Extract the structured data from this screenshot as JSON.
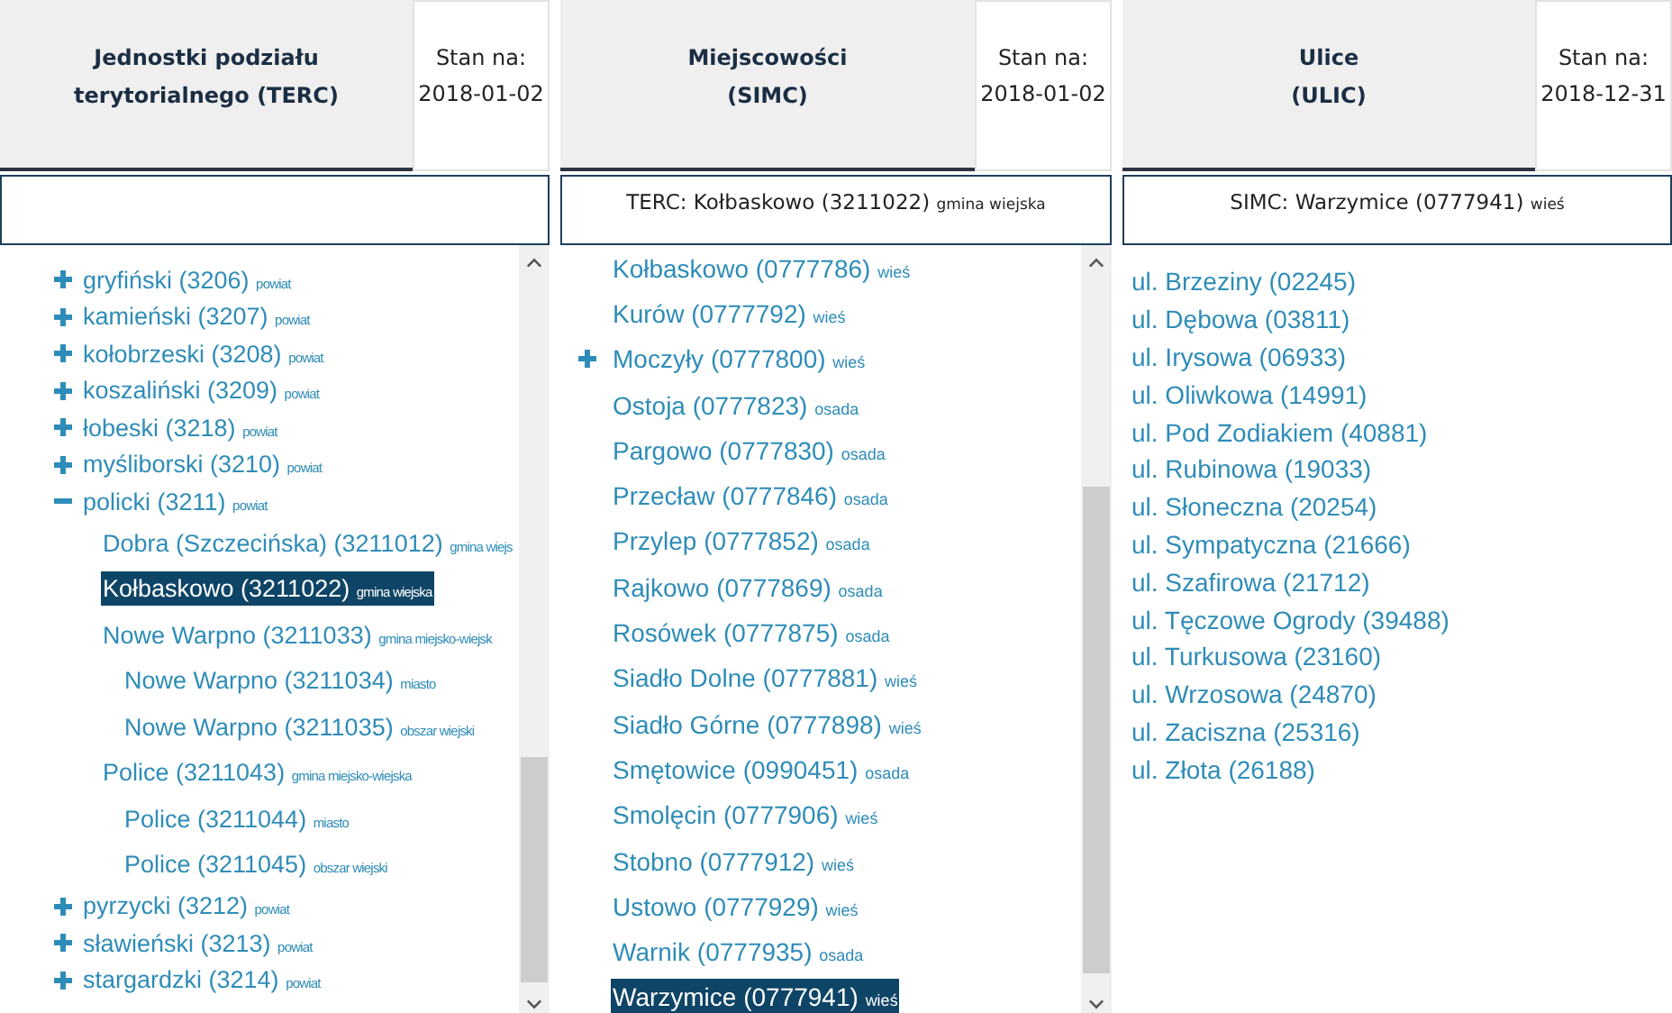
{
  "panels": [
    {
      "kind": "tree",
      "title_lines": [
        "Jednostki podziału",
        "terytorialnego (TERC)"
      ],
      "date_label": "Stan na:",
      "date": "2018-01-02",
      "items": [
        {
          "name": "gryfiński (3206)",
          "type": "powiat",
          "expanded": false,
          "selected": false
        },
        {
          "name": "kamieński (3207)",
          "type": "powiat",
          "expanded": false,
          "selected": false
        },
        {
          "name": "kołobrzeski (3208)",
          "type": "powiat",
          "expanded": false,
          "selected": false
        },
        {
          "name": "koszaliński (3209)",
          "type": "powiat",
          "expanded": false,
          "selected": false
        },
        {
          "name": "łobeski (3218)",
          "type": "powiat",
          "expanded": false,
          "selected": false
        },
        {
          "name": "myśliborski (3210)",
          "type": "powiat",
          "expanded": false,
          "selected": false
        },
        {
          "name": "policki (3211)",
          "type": "powiat",
          "expanded": true,
          "selected": false,
          "children": [
            {
              "name": "Dobra (Szczecińska) (3211012)",
              "type": "gmina wiejs",
              "selected": false
            },
            {
              "name": "Kołbaskowo (3211022)",
              "type": "gmina wiejska",
              "selected": true
            },
            {
              "name": "Nowe Warpno (3211033)",
              "type": "gmina miejsko-wiejsk",
              "selected": false,
              "children": [
                {
                  "name": "Nowe Warpno (3211034)",
                  "type": "miasto",
                  "selected": false
                },
                {
                  "name": "Nowe Warpno (3211035)",
                  "type": "obszar wiejski",
                  "selected": false
                }
              ]
            },
            {
              "name": "Police (3211043)",
              "type": "gmina miejsko-wiejska",
              "selected": false,
              "children": [
                {
                  "name": "Police (3211044)",
                  "type": "miasto",
                  "selected": false
                },
                {
                  "name": "Police (3211045)",
                  "type": "obszar wiejski",
                  "selected": false
                }
              ]
            }
          ]
        },
        {
          "name": "pyrzycki (3212)",
          "type": "powiat",
          "expanded": false,
          "selected": false
        },
        {
          "name": "sławieński (3213)",
          "type": "powiat",
          "expanded": false,
          "selected": false
        },
        {
          "name": "stargardzki (3214)",
          "type": "powiat",
          "expanded": false,
          "selected": false
        }
      ]
    },
    {
      "kind": "list",
      "title_lines": [
        "Miejscowości",
        "(SIMC)"
      ],
      "date_label": "Stan na:",
      "date": "2018-01-02",
      "context": {
        "label": "TERC: Kołbaskowo (3211022)",
        "type": "gmina wiejska"
      },
      "items": [
        {
          "name": "Kołbaskowo (0777786)",
          "type": "wieś",
          "expandable": false,
          "selected": false
        },
        {
          "name": "Kurów (0777792)",
          "type": "wieś",
          "expandable": false,
          "selected": false
        },
        {
          "name": "Moczyły (0777800)",
          "type": "wieś",
          "expandable": true,
          "selected": false
        },
        {
          "name": "Ostoja (0777823)",
          "type": "osada",
          "expandable": false,
          "selected": false
        },
        {
          "name": "Pargowo (0777830)",
          "type": "osada",
          "expandable": false,
          "selected": false
        },
        {
          "name": "Przecław (0777846)",
          "type": "osada",
          "expandable": false,
          "selected": false
        },
        {
          "name": "Przylep (0777852)",
          "type": "osada",
          "expandable": false,
          "selected": false
        },
        {
          "name": "Rajkowo (0777869)",
          "type": "osada",
          "expandable": false,
          "selected": false
        },
        {
          "name": "Rosówek (0777875)",
          "type": "osada",
          "expandable": false,
          "selected": false
        },
        {
          "name": "Siadło Dolne (0777881)",
          "type": "wieś",
          "expandable": false,
          "selected": false
        },
        {
          "name": "Siadło Górne (0777898)",
          "type": "wieś",
          "expandable": false,
          "selected": false
        },
        {
          "name": "Smętowice (0990451)",
          "type": "osada",
          "expandable": false,
          "selected": false
        },
        {
          "name": "Smolęcin (0777906)",
          "type": "wieś",
          "expandable": false,
          "selected": false
        },
        {
          "name": "Stobno (0777912)",
          "type": "wieś",
          "expandable": false,
          "selected": false
        },
        {
          "name": "Ustowo (0777929)",
          "type": "wieś",
          "expandable": false,
          "selected": false
        },
        {
          "name": "Warnik (0777935)",
          "type": "osada",
          "expandable": false,
          "selected": false
        },
        {
          "name": "Warzymice (0777941)",
          "type": "wieś",
          "expandable": false,
          "selected": true
        }
      ]
    },
    {
      "kind": "plain",
      "title_lines": [
        "Ulice",
        "(ULIC)"
      ],
      "date_label": "Stan na:",
      "date": "2018-12-31",
      "context": {
        "label": "SIMC: Warzymice (0777941)",
        "type": "wieś"
      },
      "items": [
        "ul. Brzeziny (02245)",
        "ul. Dębowa (03811)",
        "ul. Irysowa (06933)",
        "ul. Oliwkowa (14991)",
        "ul. Pod Zodiakiem (40881)",
        "ul. Rubinowa (19033)",
        "ul. Słoneczna (20254)",
        "ul. Sympatyczna (21666)",
        "ul. Szafirowa (21712)",
        "ul. Tęczowe Ogrody (39488)",
        "ul. Turkusowa (23160)",
        "ul. Wrzosowa (24870)",
        "ul. Zaciszna (25316)",
        "ul. Złota (26188)"
      ]
    }
  ]
}
